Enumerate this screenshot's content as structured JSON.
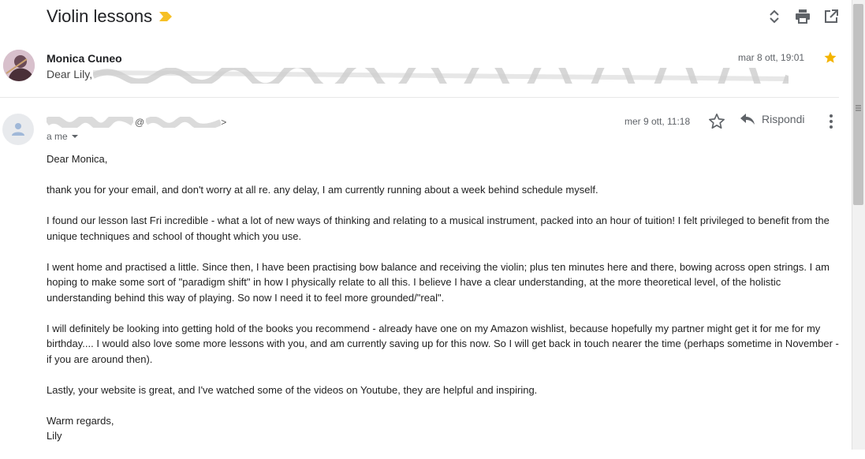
{
  "thread": {
    "subject": "Violin lessons",
    "label_icon": "importance-marker-icon",
    "label_color": "#f6c026"
  },
  "toolbar": {
    "expand_icon": "expand-collapse-icon",
    "print_icon": "print-icon",
    "open_new_window_icon": "open-in-new-window-icon"
  },
  "message1": {
    "sender": "Monica Cuneo",
    "snippet": "Dear Lily,",
    "date": "mar 8 ott, 19:01",
    "starred": true,
    "star_color": "#f4b400"
  },
  "message2": {
    "sender_email_at": "@",
    "recipient": "a me",
    "date": "mer 9 ott, 11:18",
    "reply_label": "Rispondi",
    "body": [
      "Dear Monica,",
      "thank you for your email, and don't worry at all re. any delay, I am currently running about a week behind schedule myself.",
      "I found our lesson last Fri incredible - what a lot of new ways of thinking and relating to a musical instrument, packed into an hour of tuition! I felt privileged to benefit from the unique techniques and school of thought which you use.",
      "I went home and practised a little. Since then, I have been practising bow balance and receiving the violin; plus ten minutes here and there, bowing across open strings. I am hoping to make some sort of \"paradigm shift\" in how I physically relate to all this. I believe I have a clear understanding, at the more theoretical level, of the holistic understanding behind this way of playing. So now I need it to feel more grounded/\"real\".",
      "I will definitely be looking into getting hold of the books you recommend - already have one on my Amazon wishlist, because hopefully my partner might get it for me for my birthday.... I would also love some more lessons with you, and am currently saving up for this now. So I will get back in touch nearer the time (perhaps sometime in November - if you are around then).",
      "Lastly, your website is great, and I've watched some of the videos on Youtube, they are helpful and inspiring.",
      "Warm regards,\nLily"
    ]
  }
}
